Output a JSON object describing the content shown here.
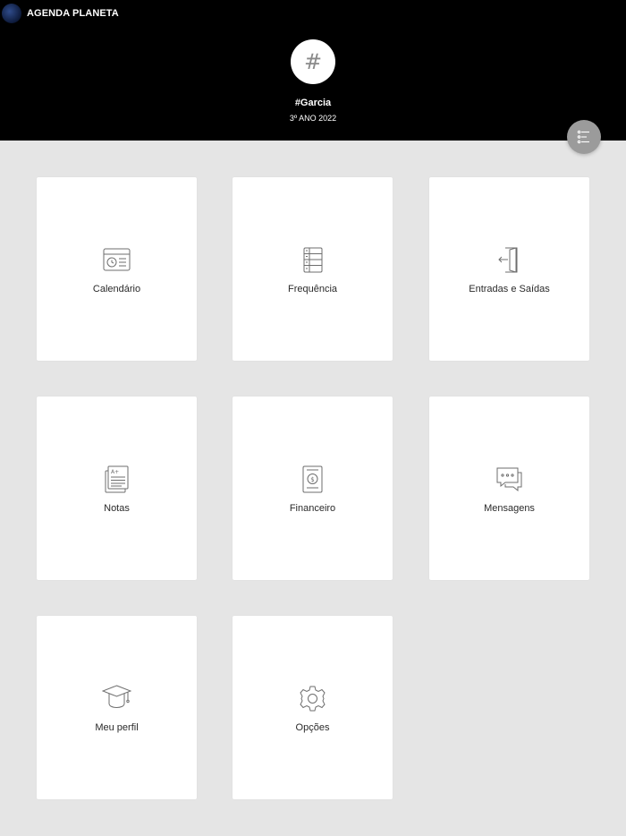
{
  "app": {
    "title": "AGENDA PLANETA"
  },
  "profile": {
    "avatar_glyph": "#",
    "name": "#Garcia",
    "class_year": "3º ANO 2022"
  },
  "menu_tiles": [
    {
      "label": "Calendário",
      "icon": "calendar-icon"
    },
    {
      "label": "Frequência",
      "icon": "attendance-icon"
    },
    {
      "label": "Entradas e Saídas",
      "icon": "door-exit-icon"
    },
    {
      "label": "Notas",
      "icon": "grades-icon"
    },
    {
      "label": "Financeiro",
      "icon": "finance-icon"
    },
    {
      "label": "Mensagens",
      "icon": "messages-icon"
    },
    {
      "label": "Meu perfil",
      "icon": "graduation-cap-icon"
    },
    {
      "label": "Opções",
      "icon": "gear-icon"
    }
  ],
  "colors": {
    "header_bg": "#000000",
    "page_bg": "#e5e5e5",
    "fab_bg": "#9b9b9b"
  }
}
